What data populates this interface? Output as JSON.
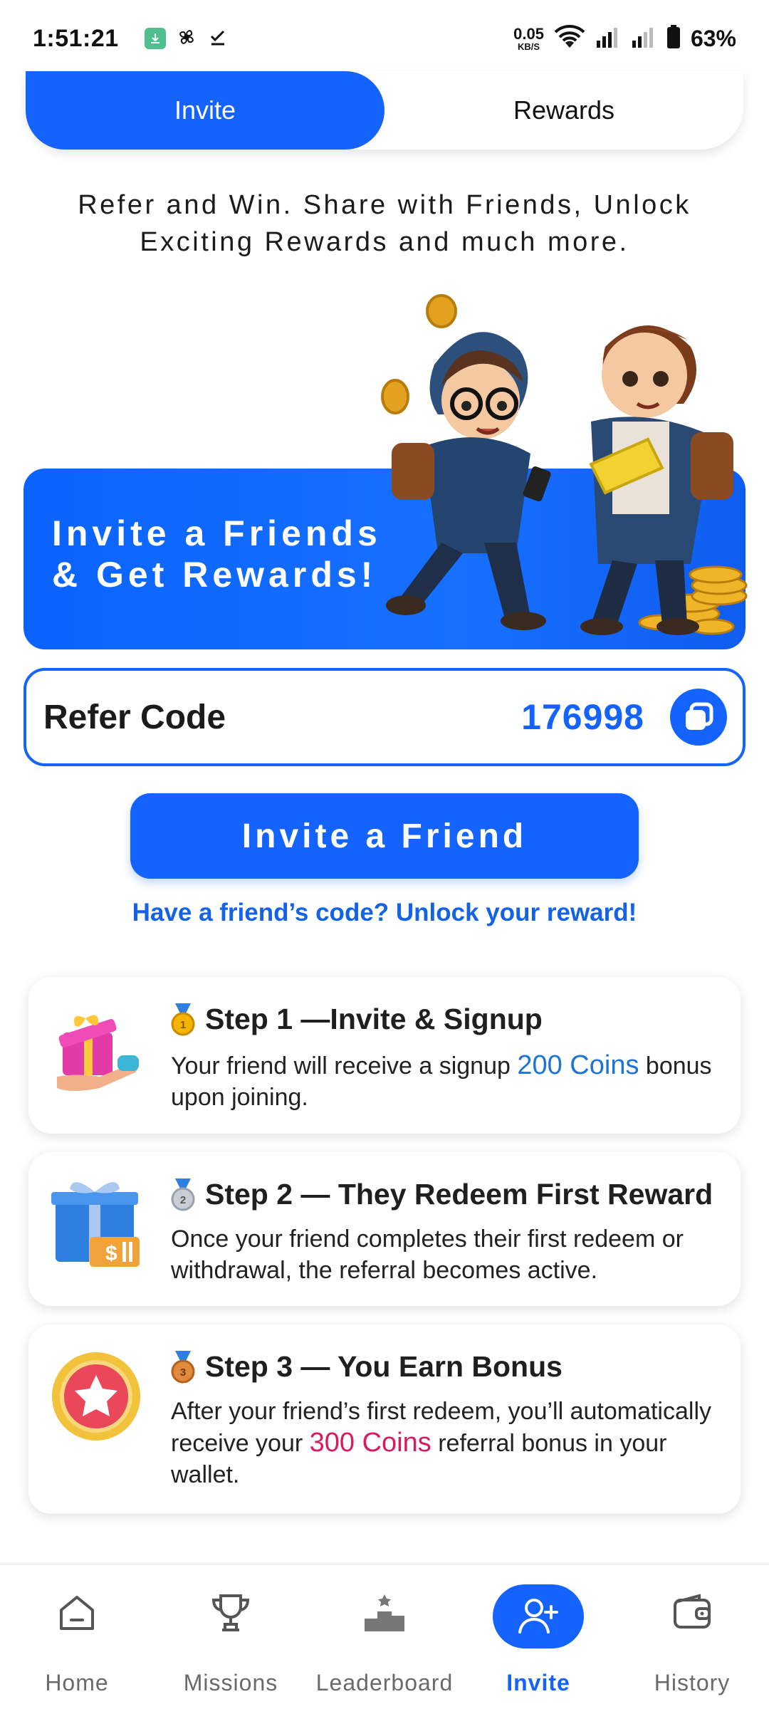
{
  "status_bar": {
    "time": "1:51:21",
    "net_speed": "0.05",
    "net_unit": "KB/S",
    "battery": "63%"
  },
  "tabs": [
    {
      "label": "Invite",
      "active": true
    },
    {
      "label": "Rewards",
      "active": false
    }
  ],
  "tagline": "Refer and Win. Share with Friends, Unlock Exciting Rewards and much more.",
  "banner": {
    "title_line1": "Invite a Friends",
    "title_line2": "& Get Rewards!"
  },
  "refer": {
    "label": "Refer Code",
    "code": "176998"
  },
  "invite_button": "Invite a Friend",
  "code_link": "Have a friend’s code? Unlock your reward!",
  "steps": [
    {
      "title": "Step 1 —Invite & Signup",
      "text_before": "Your friend will receive a signup ",
      "highlight": "200 Coins",
      "text_after": " bonus upon joining.",
      "highlight_color": "#1e74d6"
    },
    {
      "title": "Step 2 — They Redeem First Reward",
      "text": "Once your friend completes their first redeem or withdrawal, the referral becomes active."
    },
    {
      "title": "Step 3 — You Earn Bonus",
      "text_before": "After your friend’s first redeem, you’ll automatically receive your ",
      "highlight": "300 Coins",
      "text_after": " referral bonus in your wallet.",
      "highlight_color": "#d81b60"
    }
  ],
  "nav": [
    {
      "label": "Home",
      "icon": "home-icon",
      "active": false
    },
    {
      "label": "Missions",
      "icon": "trophy-icon",
      "active": false
    },
    {
      "label": "Leaderboard",
      "icon": "podium-icon",
      "active": false
    },
    {
      "label": "Invite",
      "icon": "add-user-icon",
      "active": true
    },
    {
      "label": "History",
      "icon": "wallet-icon",
      "active": false
    }
  ],
  "colors": {
    "primary": "#1463ff",
    "highlight_blue": "#1e74d6",
    "highlight_pink": "#d81b60"
  }
}
